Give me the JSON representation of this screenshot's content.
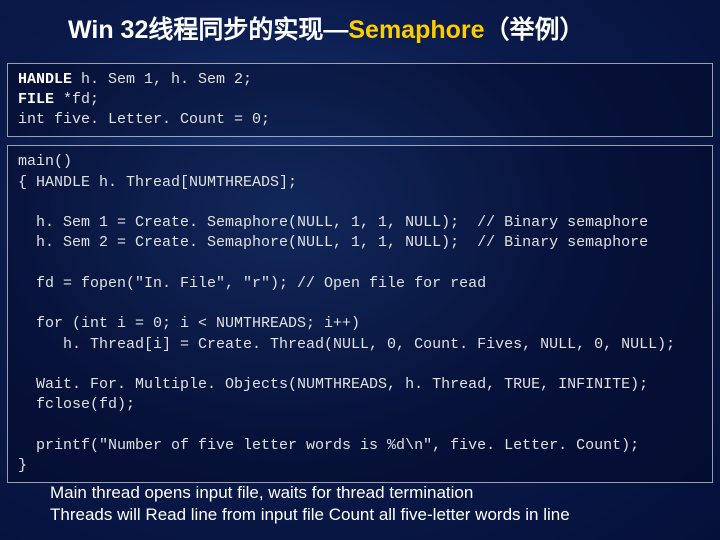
{
  "title": {
    "part1": "Win 32线程同步的实现—",
    "part2": "Semaphore",
    "part3": "（举例）"
  },
  "code_top": {
    "l1a": "HANDLE",
    "l1b": " h. Sem 1, h. Sem 2;",
    "l2a": "FILE",
    "l2b": " *fd;",
    "l3": "int five. Letter. Count = 0;"
  },
  "code_main": {
    "l1": "main()",
    "l2": "{ HANDLE h. Thread[NUMTHREADS];",
    "l3": "",
    "l4": "  h. Sem 1 = Create. Semaphore(NULL, 1, 1, NULL);  // Binary semaphore",
    "l5": "  h. Sem 2 = Create. Semaphore(NULL, 1, 1, NULL);  // Binary semaphore",
    "l6": "",
    "l7": "  fd = fopen(\"In. File\", \"r\"); // Open file for read",
    "l8": "",
    "l9": "  for (int i = 0; i < NUMTHREADS; i++)",
    "l10": "     h. Thread[i] = Create. Thread(NULL, 0, Count. Fives, NULL, 0, NULL);",
    "l11": "",
    "l12": "  Wait. For. Multiple. Objects(NUMTHREADS, h. Thread, TRUE, INFINITE);",
    "l13": "  fclose(fd);",
    "l14": "",
    "l15": "  printf(\"Number of five letter words is %d\\n\", five. Letter. Count);",
    "l16": "}"
  },
  "caption": {
    "line1": "Main thread opens input file, waits for thread termination",
    "line2": "Threads will Read line from input file Count all five-letter words in line"
  }
}
